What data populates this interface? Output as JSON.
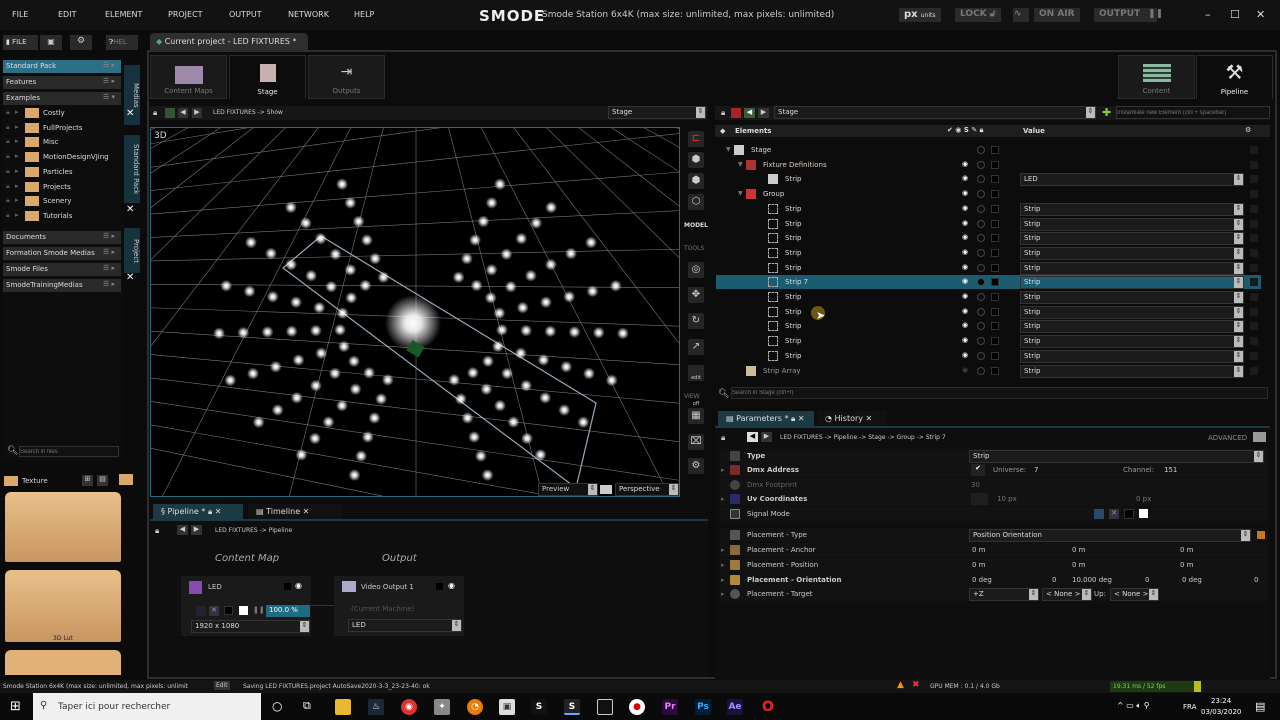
{
  "menu": [
    "FILE",
    "EDIT",
    "ELEMENT",
    "PROJECT",
    "OUTPUT",
    "NETWORK",
    "HELP"
  ],
  "app": {
    "logo": "SMODE",
    "title": "Smode Station 6x4K (max size: unlimited, max pixels: unlimited)",
    "px": "px",
    "px_units": "units",
    "lock": "LOCK",
    "on_air": "ON AIR",
    "output": "OUTPUT"
  },
  "left": {
    "tabs": [
      "FILE",
      "HEL"
    ],
    "packs": [
      {
        "label": "Standard Pack"
      },
      {
        "label": "Features"
      },
      {
        "label": "Examples"
      }
    ],
    "folders": [
      "Costly",
      "FullProjects",
      "Misc",
      "MotionDesignVJing",
      "Particles",
      "Projects",
      "Scenery",
      "Tutorials"
    ],
    "libraries": [
      "Documents",
      "Formation Smode Medias",
      "Smode Files",
      "SmodeTrainingMedias"
    ],
    "search_placeholder": "Search in files",
    "texture": "Texture",
    "thumb_label": "3D Lut",
    "side_tabs": [
      "Medias",
      "Standard Pack",
      "Project"
    ]
  },
  "project_tab": "Current project - LED FIXTURES *",
  "tiles": {
    "content_maps": "Content Maps",
    "stage": "Stage",
    "outputs": "Outputs",
    "content": "Content",
    "pipeline": "Pipeline"
  },
  "viewport": {
    "breadcrumb": "LED FIXTURES -> Show",
    "select": "Stage",
    "label3d": "3D",
    "preview": "Preview",
    "camera": "Perspective",
    "model": "MODEL",
    "tools": "TOOLS",
    "edit_off": "edit off",
    "view": "VIEW"
  },
  "elements": {
    "select": "Stage",
    "instantiate_placeholder": "Instantiate new Element (ctrl + spacebar)",
    "header": "Elements",
    "value_header": "Value",
    "search_placeholder": "Search in Stage (ctrl+f)",
    "rows": [
      {
        "name": "Stage",
        "indent": 0,
        "icon": "stage",
        "value": null
      },
      {
        "name": "Fixture Definitions",
        "indent": 1,
        "icon": "fixture",
        "value": null
      },
      {
        "name": "Strip",
        "indent": 2,
        "icon": "strip-def",
        "value": "LED"
      },
      {
        "name": "Group",
        "indent": 1,
        "icon": "group",
        "value": null
      },
      {
        "name": "Strip",
        "indent": 2,
        "icon": "strip",
        "value": "Strip"
      },
      {
        "name": "Strip",
        "indent": 2,
        "icon": "strip",
        "value": "Strip"
      },
      {
        "name": "Strip",
        "indent": 2,
        "icon": "strip",
        "value": "Strip"
      },
      {
        "name": "Strip",
        "indent": 2,
        "icon": "strip",
        "value": "Strip"
      },
      {
        "name": "Strip",
        "indent": 2,
        "icon": "strip",
        "value": "Strip"
      },
      {
        "name": "Strip 7",
        "indent": 2,
        "icon": "strip",
        "value": "Strip",
        "selected": true
      },
      {
        "name": "Strip",
        "indent": 2,
        "icon": "strip",
        "value": "Strip"
      },
      {
        "name": "Strip",
        "indent": 2,
        "icon": "strip",
        "value": "Strip"
      },
      {
        "name": "Strip",
        "indent": 2,
        "icon": "strip",
        "value": "Strip"
      },
      {
        "name": "Strip",
        "indent": 2,
        "icon": "strip",
        "value": "Strip"
      },
      {
        "name": "Strip",
        "indent": 2,
        "icon": "strip",
        "value": "Strip"
      },
      {
        "name": "Strip Array",
        "indent": 1,
        "icon": "array",
        "value": "Strip"
      }
    ]
  },
  "params": {
    "tab": "Parameters *",
    "history": "History",
    "breadcrumb": "LED FIXTURES -> Pipeline -> Stage -> Group -> Strip 7",
    "advanced": "ADVANCED",
    "type": {
      "label": "Type",
      "value": "Strip"
    },
    "dmx": {
      "label": "Dmx Address",
      "universe_label": "Universe:",
      "universe": "7",
      "channel_label": "Channel:",
      "channel": "151"
    },
    "footprint": {
      "label": "Dmx Footprint",
      "value": "30"
    },
    "uv": {
      "label": "Uv Coordinates",
      "v1": "10 px",
      "v2": "0 px"
    },
    "signal": {
      "label": "Signal Mode"
    },
    "ptype": {
      "label": "Placement - Type",
      "value": "Position Orientation"
    },
    "anchor": {
      "label": "Placement - Anchor",
      "values": [
        "0 m",
        "0 m",
        "0 m"
      ]
    },
    "position": {
      "label": "Placement - Position",
      "values": [
        "0 m",
        "0 m",
        "0 m"
      ]
    },
    "orientation": {
      "label": "Placement - Orientation",
      "values": [
        "0 deg",
        "0",
        "10.000 deg",
        "0",
        "0 deg",
        "0"
      ]
    },
    "target": {
      "label": "Placement - Target",
      "value": "+Z",
      "none1": "< None >",
      "up": "Up:",
      "none2": "< None >"
    }
  },
  "pipeline": {
    "tab": "Pipeline *",
    "timeline": "Timeline",
    "breadcrumb": "LED FIXTURES -> Pipeline",
    "col1": "Content Map",
    "col2": "Output",
    "node1": {
      "name": "LED",
      "percent": "100.0 %",
      "resolution": "1920 x 1080"
    },
    "node2": {
      "name": "Video Output 1",
      "machine": "(Current Machine)",
      "target": "LED"
    }
  },
  "status": {
    "left": "Smode Station 6x4K (max size: unlimited, max pixels: unlimit",
    "edit": "Edit",
    "message": "Saving LED FIXTURES.project AutoSave2020-3-3_23-23-40: ok",
    "gpu": "GPU MEM : 0.1 / 4.0 Gb",
    "fps": "19.31 ms / 52 fps"
  },
  "taskbar": {
    "search": "Taper ici pour rechercher",
    "lang": "FRA",
    "time": "23:24",
    "date": "03/03/2020"
  }
}
